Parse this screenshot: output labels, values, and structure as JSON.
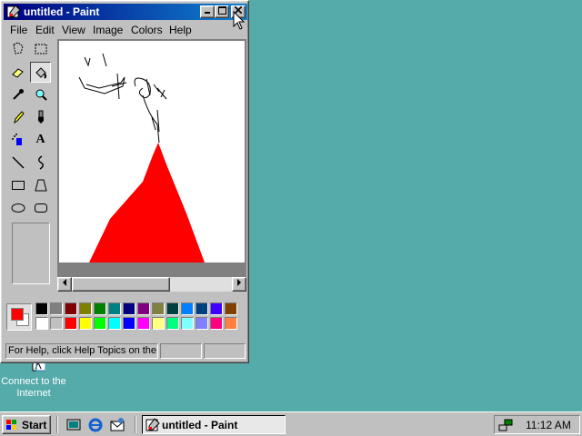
{
  "desktop": {
    "background": "#55AAAA",
    "icons": [
      {
        "label": "Connect to the Internet",
        "icon": "connect-internet-icon"
      }
    ]
  },
  "window": {
    "title": "untitled - Paint",
    "app_icon": "paint-app-icon",
    "controls": {
      "minimize": "minimize-icon",
      "maximize": "maximize-icon",
      "close": "close-icon"
    },
    "menu": [
      "File",
      "Edit",
      "View",
      "Image",
      "Colors",
      "Help"
    ],
    "tools": [
      "free-form-select",
      "rect-select",
      "eraser",
      "fill-with-color",
      "pick-color",
      "magnifier",
      "pencil",
      "brush",
      "airbrush",
      "text",
      "line",
      "curve",
      "rectangle",
      "polygon",
      "ellipse",
      "rounded-rectangle"
    ],
    "selected_tool": "fill-with-color",
    "text_tool_glyph": "A",
    "canvas": {
      "background": "#FFFFFF",
      "fill_color": "#FF0000",
      "stroke_color": "#000000"
    },
    "colors": {
      "foreground": "#FF0000",
      "background": "#FFFFFF",
      "palette_row1": [
        "#000000",
        "#808080",
        "#800000",
        "#808000",
        "#008000",
        "#008080",
        "#000080",
        "#800080",
        "#808040",
        "#004040",
        "#0080FF",
        "#004080",
        "#4000FF",
        "#804000"
      ],
      "palette_row2": [
        "#FFFFFF",
        "#C0C0C0",
        "#FF0000",
        "#FFFF00",
        "#00FF00",
        "#00FFFF",
        "#0000FF",
        "#FF00FF",
        "#FFFF80",
        "#00FF80",
        "#80FFFF",
        "#8080FF",
        "#FF0080",
        "#FF8040"
      ]
    },
    "status_text": "For Help, click Help Topics on the Help Menu."
  },
  "taskbar": {
    "start_label": "Start",
    "quick_launch": [
      "show-desktop-icon",
      "internet-explorer-icon",
      "outlook-express-icon"
    ],
    "tasks": [
      {
        "label": "untitled - Paint",
        "icon": "paint-app-icon",
        "active": true
      }
    ],
    "tray_icons": [
      "network-icon"
    ],
    "clock": "11:12 AM"
  }
}
